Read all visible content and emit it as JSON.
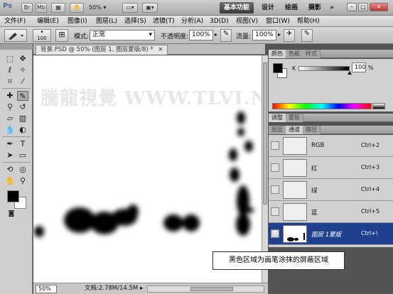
{
  "appbar": {
    "logo": "Ps",
    "br_label": "Br",
    "mb_label": "Mb",
    "zoom": "50%",
    "workspaces": [
      "基本功能",
      "设计",
      "绘画",
      "摄影"
    ],
    "min_glyph": "–",
    "max_glyph": "□",
    "close_glyph": "×"
  },
  "menubar": {
    "items": [
      "文件(F)",
      "编辑(E)",
      "图像(I)",
      "图层(L)",
      "选择(S)",
      "滤镜(T)",
      "分析(A)",
      "3D(D)",
      "视图(V)",
      "窗口(W)",
      "帮助(H)"
    ]
  },
  "options": {
    "brush_size": "100",
    "mode_label": "模式:",
    "mode_value": "正常",
    "opacity_label": "不透明度:",
    "opacity_value": "100%",
    "flow_label": "流量:",
    "flow_value": "100%"
  },
  "document": {
    "tab_title": "背景.PSD @ 50% (图层 1, 图层蒙版/8) *",
    "watermark": "騰龍視覺 WWW.TLVI.NET",
    "zoom": "50%",
    "doc_info": "文档:2.78M/14.5M"
  },
  "color_panel": {
    "tabs": [
      "颜色",
      "色板",
      "样式"
    ],
    "channel_label": "K",
    "value": "100",
    "unit": "%",
    "value_fraction": 1.0
  },
  "adjust_tabs": [
    "调整",
    "蒙版"
  ],
  "layers_panel": {
    "tabs": [
      "图层",
      "通道",
      "路径"
    ],
    "channels": [
      {
        "name": "RGB",
        "shortcut": "Ctrl+2"
      },
      {
        "name": "红",
        "shortcut": "Ctrl+3"
      },
      {
        "name": "绿",
        "shortcut": "Ctrl+4"
      },
      {
        "name": "蓝",
        "shortcut": "Ctrl+5"
      },
      {
        "name": "图层 1蒙版",
        "shortcut": "Ctrl+\\"
      }
    ]
  },
  "callout": "黑色区域为画笔涂抹的屏蔽区域",
  "colors": {
    "accent_workspace": "#3a3a3a",
    "selected_row": "#1f3f8f"
  }
}
